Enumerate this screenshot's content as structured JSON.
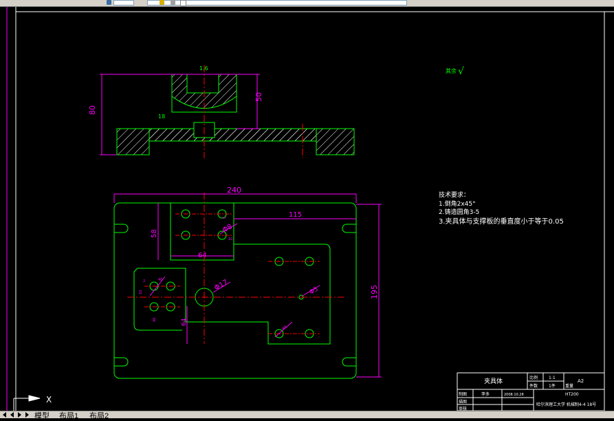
{
  "tabs": [
    "模型",
    "布局1",
    "布局2"
  ],
  "annotations": {
    "check_label": "其余",
    "check_mark": "√",
    "tech_title": "技术要求：",
    "tech_1": "1.倒角2x45°",
    "tech_2": "2.铸造圆角3-5",
    "tech_3": "3.夹具体与支撑板的垂直度小于等于0.05"
  },
  "dimensions": {
    "d1_6": "1.6",
    "d50": "50",
    "d80": "80",
    "d18": "18",
    "d240": "240",
    "d115": "115",
    "d58": "58",
    "d64": "64",
    "d195": "195",
    "phi8": "Φ8",
    "phi17": "Φ17",
    "phi5": "Φ5",
    "d64b": "64",
    "d10": "10",
    "d40": "40",
    "d5": "5",
    "d2": "2",
    "d40b": "40",
    "d10b": "10",
    "phi8b": "Φ8"
  },
  "title_block": {
    "name": "夹具体",
    "scale_label": "比例",
    "scale": "1:1",
    "qty_label": "件数",
    "qty": "1件",
    "weight_label": "重量",
    "size": "A2",
    "material": "HT200",
    "drawer_label": "制图",
    "drawer": "李多",
    "date": "2008.10.28",
    "check_label": "描图",
    "review_label": "审核",
    "school": "哈尔滨理工大学 机械制4-4 18号"
  },
  "ucs": {
    "x_label": "X"
  },
  "colors": {
    "outline": "#00ff00",
    "dim": "#ff00ff",
    "center": "#ff0000",
    "text": "#ffffff",
    "hatch": "#ffffff"
  }
}
